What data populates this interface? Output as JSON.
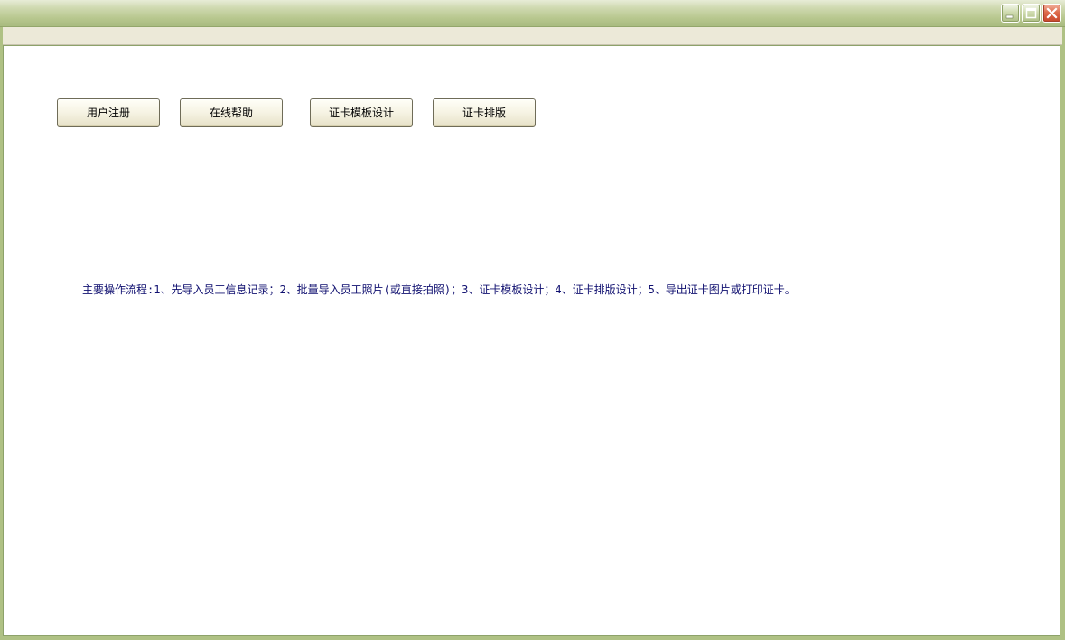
{
  "toolbar": {
    "buttons": [
      {
        "label": "用户注册"
      },
      {
        "label": "在线帮助"
      },
      {
        "label": "证卡模板设计"
      },
      {
        "label": "证卡排版"
      }
    ]
  },
  "main": {
    "instructions": "主要操作流程:1、先导入员工信息记录；2、批量导入员工照片(或直接拍照)；3、证卡模板设计；4、证卡排版设计；5、导出证卡图片或打印证卡。"
  },
  "window_controls": {
    "icons": [
      "minimize-icon",
      "maximize-icon",
      "close-icon"
    ]
  },
  "colors": {
    "title_bar": "#b7c78e",
    "menu_bar": "#ece9d8",
    "client_bg": "#ffffff",
    "instruction_text": "#101070",
    "button_face": "#f6f3e3",
    "close_button": "#de6b4b"
  }
}
